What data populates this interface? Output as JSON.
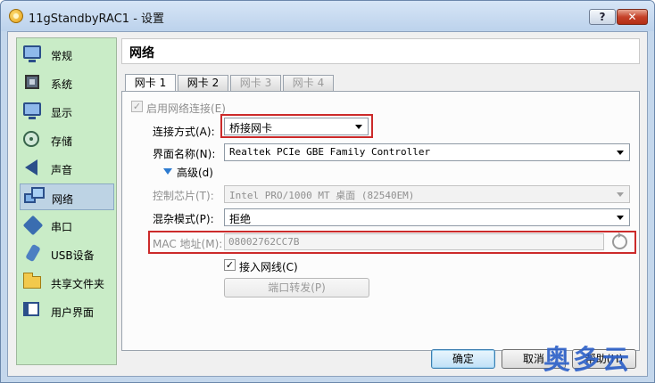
{
  "window": {
    "title": "11gStandbyRAC1 - 设置",
    "help_label": "?",
    "close_label": "✕"
  },
  "sidebar": {
    "items": [
      {
        "label": "常规",
        "icon": "monitor-icon"
      },
      {
        "label": "系统",
        "icon": "chip-icon"
      },
      {
        "label": "显示",
        "icon": "display-icon"
      },
      {
        "label": "存储",
        "icon": "disk-icon"
      },
      {
        "label": "声音",
        "icon": "speaker-icon"
      },
      {
        "label": "网络",
        "icon": "network-icon",
        "selected": true
      },
      {
        "label": "串口",
        "icon": "serial-port-icon"
      },
      {
        "label": "USB设备",
        "icon": "usb-icon"
      },
      {
        "label": "共享文件夹",
        "icon": "folder-icon"
      },
      {
        "label": "用户界面",
        "icon": "user-interface-icon"
      }
    ]
  },
  "page": {
    "title": "网络"
  },
  "tabs": [
    {
      "label": "网卡 1",
      "active": true
    },
    {
      "label": "网卡 2",
      "active": false
    },
    {
      "label": "网卡 3",
      "disabled": true
    },
    {
      "label": "网卡 4",
      "disabled": true
    }
  ],
  "form": {
    "enable_label": "启用网络连接(E)",
    "attach_label": "连接方式(A):",
    "attach_value": "桥接网卡",
    "name_label": "界面名称(N):",
    "name_value": "Realtek PCIe GBE Family Controller",
    "advanced_label": "高级(d)",
    "adapter_label": "控制芯片(T):",
    "adapter_value": "Intel PRO/1000 MT 桌面 (82540EM)",
    "promisc_label": "混杂模式(P):",
    "promisc_value": "拒绝",
    "mac_label": "MAC 地址(M):",
    "mac_value": "08002762CC7B",
    "cable_label": "接入网线(C)",
    "port_forward_label": "端口转发(P)"
  },
  "footer": {
    "ok_label": "确定",
    "cancel_label": "取消",
    "help_label": "帮助(H)"
  },
  "watermark": "奥多云",
  "colors": {
    "highlight": "#cc2a2a",
    "sidebar_bg": "#c9ecc7",
    "title_bg": "#c4d7ec"
  }
}
